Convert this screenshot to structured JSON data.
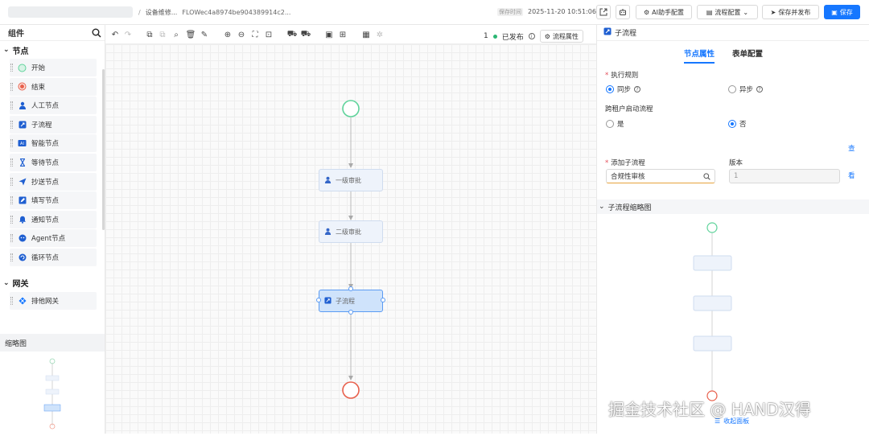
{
  "header": {
    "breadcrumb_sep": "/",
    "flow_name": "设备维修...",
    "flow_id": "FLOWec4a8974be904389914c2...",
    "saved_label": "保存时间",
    "saved_time": "2025-11-20 10:51:06",
    "ai_btn": "AI助手配置",
    "config_btn": "流程配置",
    "save_publish_btn": "保存并发布",
    "save_btn": "保存"
  },
  "sidebar": {
    "title": "组件",
    "nodes_section": "节点",
    "items": [
      {
        "label": "开始",
        "icon": "start-circle-icon"
      },
      {
        "label": "结束",
        "icon": "end-circle-icon"
      },
      {
        "label": "人工节点",
        "icon": "user-icon"
      },
      {
        "label": "子流程",
        "icon": "subflow-icon"
      },
      {
        "label": "智能节点",
        "icon": "ai-icon"
      },
      {
        "label": "等待节点",
        "icon": "hourglass-icon"
      },
      {
        "label": "抄送节点",
        "icon": "send-icon"
      },
      {
        "label": "填写节点",
        "icon": "edit-icon"
      },
      {
        "label": "通知节点",
        "icon": "bell-icon"
      },
      {
        "label": "Agent节点",
        "icon": "agent-icon"
      },
      {
        "label": "循环节点",
        "icon": "loop-icon"
      }
    ],
    "gateway_section": "网关",
    "gateway_items": [
      {
        "label": "排他网关",
        "icon": "gateway-icon"
      }
    ],
    "minimap_title": "缩略图"
  },
  "canvas_toolbar": {
    "version": "1",
    "status": "已发布",
    "props_btn": "流程属性"
  },
  "canvas": {
    "nodes": [
      {
        "label": "一级审批"
      },
      {
        "label": "二级审批"
      },
      {
        "label": "子流程"
      }
    ]
  },
  "panel": {
    "title": "子流程",
    "tab_node": "节点属性",
    "tab_form": "表单配置",
    "exec_rule_label": "执行规则",
    "sync": "同步",
    "async": "异步",
    "cross_tenant_label": "跨租户启动流程",
    "yes": "是",
    "no": "否",
    "view": "查",
    "add_subflow_label": "添加子流程",
    "subflow_value": "合规性审核",
    "version_label": "版本",
    "version_value": "1",
    "view2": "看",
    "thumb_title": "子流程缩略图",
    "collapse": "收起面板"
  },
  "watermark": "掘金技术社区 @ HAND汉得",
  "colors": {
    "primary": "#1677ff",
    "start": "#2bb673",
    "end": "#e8604c",
    "node_bg": "#eef3fb",
    "selected": "#cfe3fb"
  }
}
